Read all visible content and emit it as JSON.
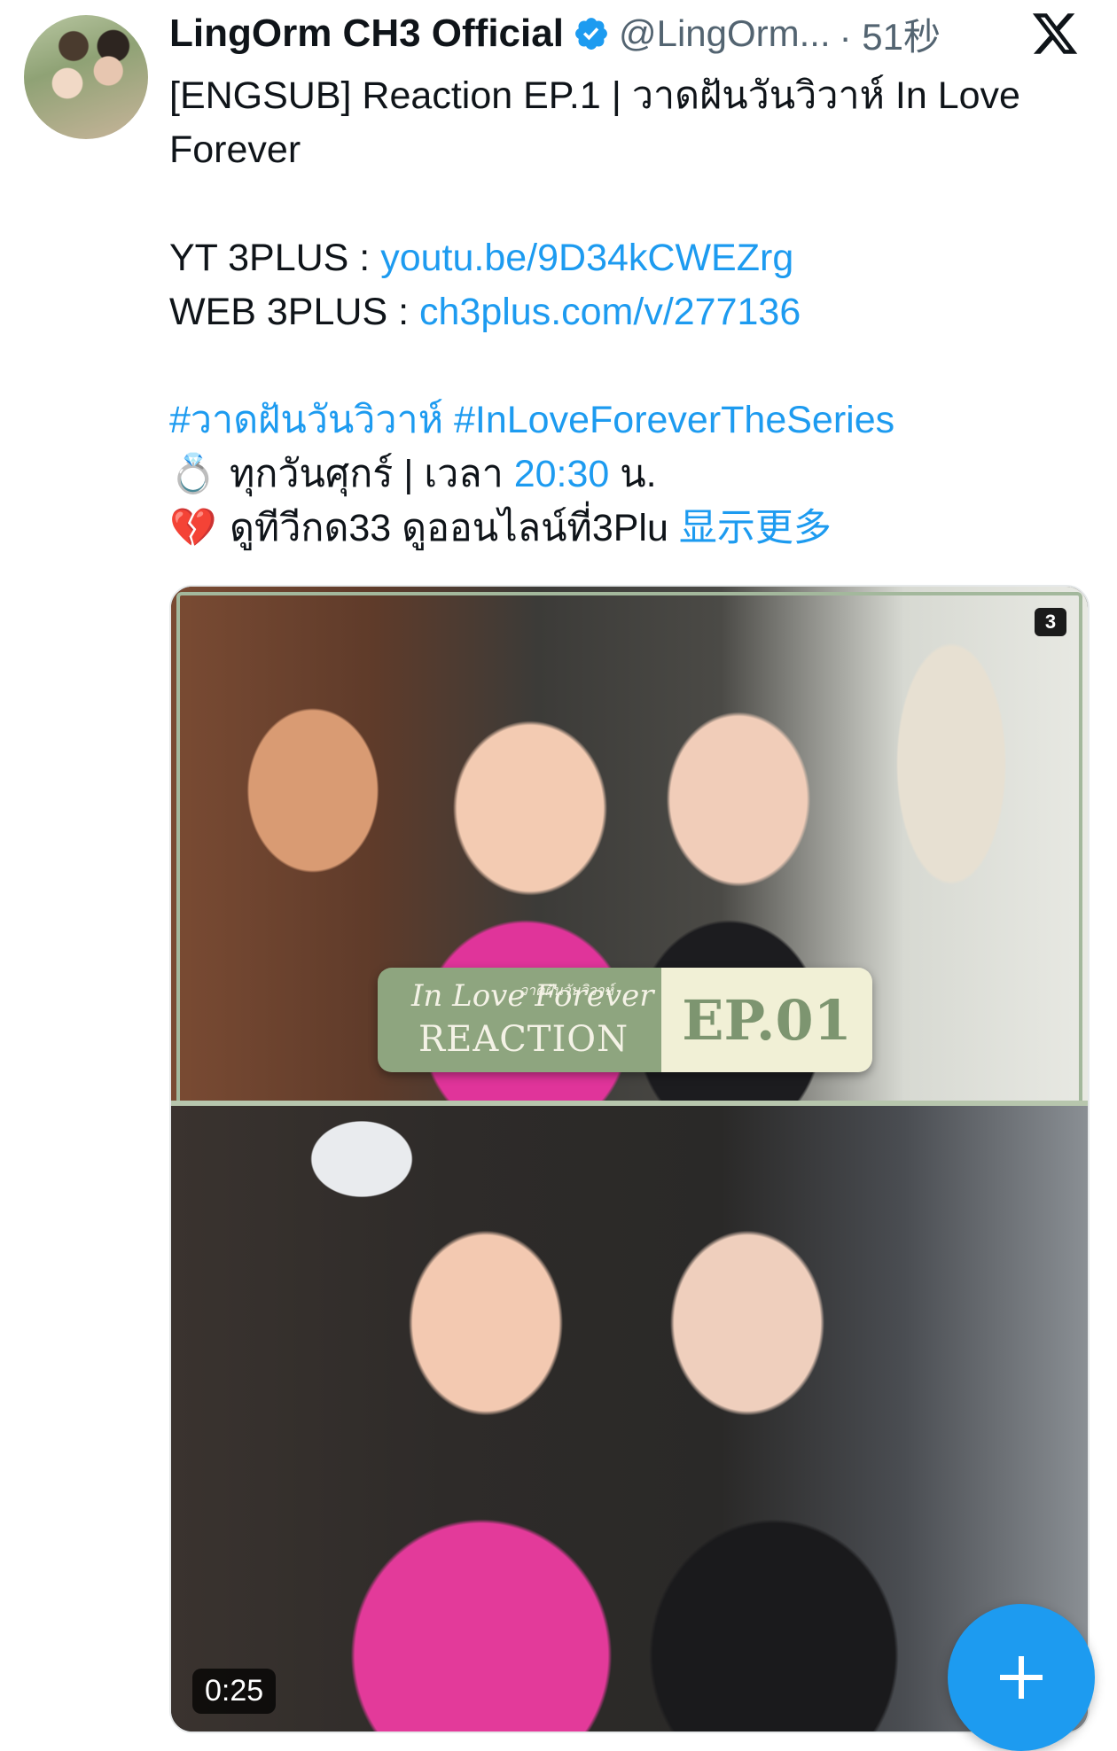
{
  "tweet": {
    "display_name": "LingOrm CH3 Official",
    "handle": "@LingOrm...",
    "time": "· 51秒",
    "lines": {
      "l1": "[ENGSUB] Reaction EP.1 | วาดฝันวันวิวาห์ In Love",
      "l2": "Forever",
      "yt_label": "YT 3PLUS : ",
      "yt_link": "youtu.be/9D34kCWEZrg",
      "web_label": "WEB 3PLUS : ",
      "web_link": "ch3plus.com/v/277136",
      "hashtags": "#วาดฝันวันวิวาห์ #InLoveForeverTheSeries",
      "l6_emoji": "💍",
      "l6_text": "ทุกวันศุกร์ | เวลา ",
      "l6_time": "20:30",
      "l6_end": " น.",
      "l7_emoji": "💔",
      "l7_text": "ดูทีวีกด33 ดูออนไลน์ที่3Plu ",
      "show_more": "显示更多"
    }
  },
  "media": {
    "badge": "3",
    "banner": {
      "script": "In Love Forever",
      "thai": "วาดฝันวันวิวาห์",
      "reaction": "REACTION",
      "episode": "EP.01"
    },
    "duration": "0:25"
  },
  "icons": {
    "verified": "verified-badge-icon",
    "x_logo": "x-logo-icon",
    "compose": "plus-icon"
  },
  "colors": {
    "link": "#1d9bf0",
    "verified": "#1d9bf0",
    "fab": "#1d9bf0",
    "handle": "#536471"
  }
}
